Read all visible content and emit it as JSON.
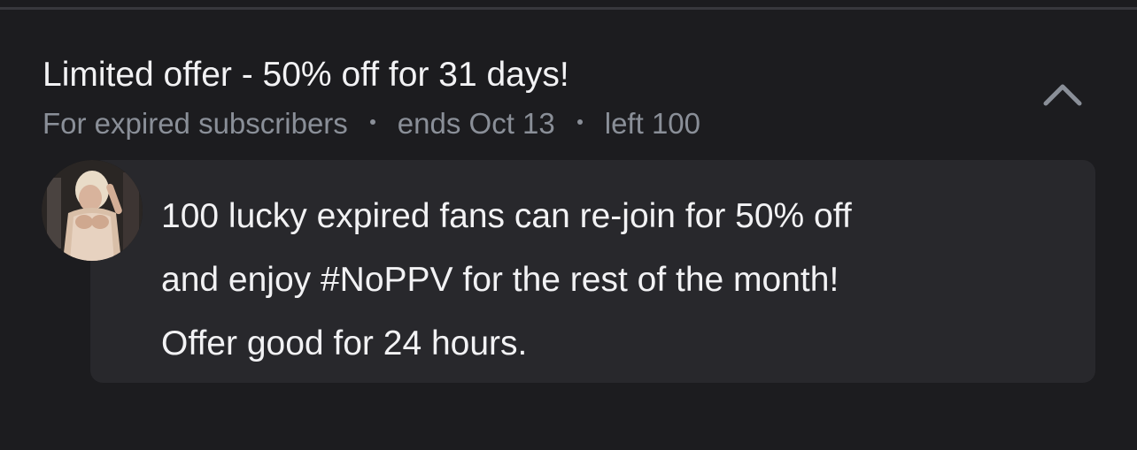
{
  "offer": {
    "title": "Limited offer - 50% off for 31 days!",
    "audience": "For expired subscribers",
    "ends": "ends Oct 13",
    "remaining": "left 100",
    "message_lines": [
      "100 lucky expired fans can re-join for 50% off",
      "and enjoy #NoPPV for the rest of the month!",
      "Offer good for 24 hours."
    ]
  },
  "icons": {
    "collapse": "chevron-up-icon",
    "avatar": "avatar"
  },
  "colors": {
    "background": "#1c1c1f",
    "bubble": "#28282c",
    "text_primary": "#f2f2f4",
    "text_secondary": "#8a8f98"
  }
}
